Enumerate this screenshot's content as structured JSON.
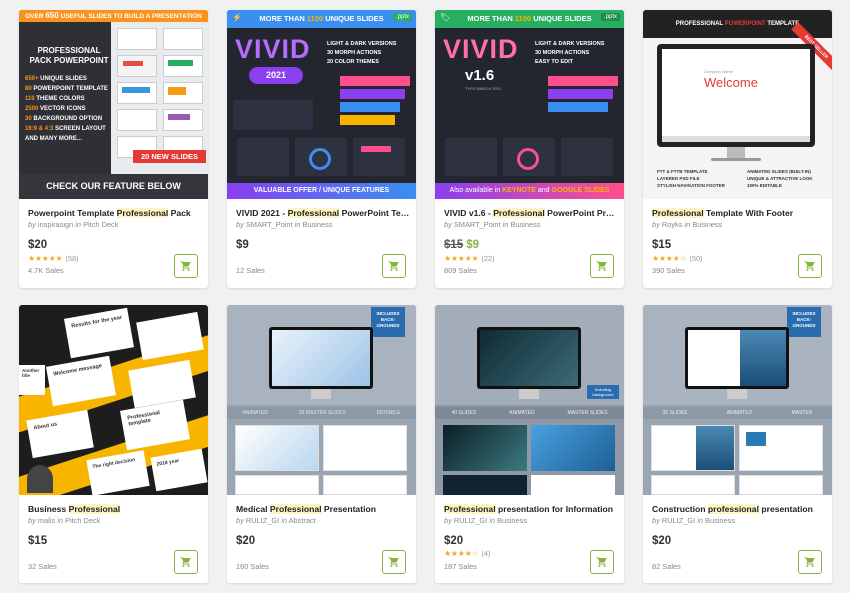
{
  "cards": [
    {
      "title_pre": "Powerpoint Template ",
      "title_hl": "Professional",
      "title_post": " Pack",
      "by": "by",
      "author": "inspirasign",
      "in": "in",
      "category": "Pitch Deck",
      "price": "$20",
      "old_price": "",
      "rating_count": "(58)",
      "rating_stars": 4.5,
      "sales": "4.7K Sales",
      "thumb": {
        "banner_pre": "OVER ",
        "banner_num": "650",
        "banner_post": " USEFUL SLIDES TO BUILD A PRESENTATION",
        "heading": "PROFESSIONAL PACK POWERPOINT",
        "features": [
          {
            "num": "650+",
            "text": " UNIQUE SLIDES"
          },
          {
            "num": "80",
            "text": " POWERPOINT TEMPLATE"
          },
          {
            "num": "110",
            "text": " THEME COLORS"
          },
          {
            "num": "2500",
            "text": " VECTOR ICONS"
          },
          {
            "num": "30",
            "text": " BACKGROUND OPTION"
          },
          {
            "num": "16:9 & 4:3",
            "text": " SCREEN LAYOUT"
          },
          {
            "num": "",
            "text": "AND MANY MORE..."
          }
        ],
        "badge": "20 NEW SLIDES",
        "footer": "CHECK OUR FEATURE BELOW"
      }
    },
    {
      "title_pre": "VIVID 2021 - ",
      "title_hl": "Professional",
      "title_post": " PowerPoint Template",
      "by": "by",
      "author": "SMART_Point",
      "in": "in",
      "category": "Business",
      "price": "$9",
      "old_price": "",
      "rating_count": "",
      "rating_stars": 0,
      "sales": "12 Sales",
      "thumb": {
        "banner_pre": "MORE THAN ",
        "banner_num": "1100",
        "banner_post": " UNIQUE SLIDES",
        "tag": ".pptx",
        "logo": "VIVID",
        "version": "2021",
        "bullets": [
          "LIGHT & DARK VERSIONS",
          "30 MORPH ACTIONS",
          "20 COLOR THEMES"
        ],
        "footer": "VALUABLE OFFER / UNIQUE FEATURES"
      }
    },
    {
      "title_pre": "VIVID v1.6 - ",
      "title_hl": "Professional",
      "title_post": " PowerPoint Presentation",
      "by": "by",
      "author": "SMART_Point",
      "in": "in",
      "category": "Business",
      "price": "$9",
      "old_price": "$15",
      "rating_count": "(22)",
      "rating_stars": 5,
      "sales": "809 Sales",
      "thumb": {
        "banner_pre": "MORE THAN ",
        "banner_num": "1100",
        "banner_post": " UNIQUE SLIDES",
        "tag": ".pptx",
        "logo": "VIVID",
        "version": "v1.6",
        "update": "TYPE MARCH 2021",
        "bullets": [
          "LIGHT & DARK VERSIONS",
          "30 MORPH ACTIONS",
          "EASY TO EDIT"
        ],
        "footer_pre": "Also available in ",
        "footer_a": "KEYNOTE",
        "footer_mid": " and ",
        "footer_b": "GOOGLE SLIDES"
      }
    },
    {
      "title_pre": "",
      "title_hl": "Professional",
      "title_post": " Template With Footer",
      "by": "by",
      "author": "Royks",
      "in": "in",
      "category": "Business",
      "price": "$15",
      "old_price": "",
      "rating_count": "(50)",
      "rating_stars": 4,
      "sales": "390 Sales",
      "thumb": {
        "heading_pre": "PROFESSIONAL ",
        "heading_hl": "POWERPOINT",
        "heading_post": " TEMPLATE",
        "ribbon": "BEST SELLER",
        "screen_small": "Company Name",
        "screen_title": "Welcome",
        "features_left": [
          "FTT & FTTB TEMPLATE",
          "LAYERED PSD FILE",
          "STYLISH NAVIGATION FOOTER"
        ],
        "features_right": [
          "ANIMATED SLIDES (BUILT-IN)",
          "UNIQUE & ATTRACTIVE LOOK",
          "100% EDITABLE"
        ]
      }
    },
    {
      "title_pre": "Business ",
      "title_hl": "Professional",
      "title_post": "",
      "by": "by",
      "author": "malis",
      "in": "in",
      "category": "Pitch Deck",
      "price": "$15",
      "old_price": "",
      "rating_count": "",
      "rating_stars": 0,
      "sales": "32 Sales",
      "thumb": {
        "slides": [
          "Results for the year",
          "Welcome message",
          "Professional template",
          "About us",
          "The right decision",
          "2018 year",
          "Another title"
        ]
      }
    },
    {
      "title_pre": "Medical ",
      "title_hl": "Professional",
      "title_post": " Presentation",
      "by": "by",
      "author": "RULIZ_GI",
      "in": "in",
      "category": "Abstract",
      "price": "$20",
      "old_price": "",
      "rating_count": "",
      "rating_stars": 0,
      "sales": "160 Sales",
      "thumb": {
        "badge": "INCLUDES BACK-GROUNDS",
        "strip": [
          "ANIMATED",
          "25 MASTER SLIDES",
          "EDITABLE"
        ]
      }
    },
    {
      "title_pre": "",
      "title_hl": "Professional",
      "title_post": " presentation for Information",
      "by": "by",
      "author": "RULIZ_GI",
      "in": "in",
      "category": "Business",
      "price": "$20",
      "old_price": "",
      "rating_count": "(4)",
      "rating_stars": 4,
      "sales": "187 Sales",
      "thumb": {
        "badge": "Including background",
        "strip": [
          "40 SLIDES",
          "ANIMATED",
          "MASTER SLIDES"
        ]
      }
    },
    {
      "title_pre": "Construction ",
      "title_hl": "professional",
      "title_post": " presentation",
      "by": "by",
      "author": "RULIZ_GI",
      "in": "in",
      "category": "Business",
      "price": "$20",
      "old_price": "",
      "rating_count": "",
      "rating_stars": 0,
      "sales": "82 Sales",
      "thumb": {
        "badge": "INCLUDES BACK-GROUNDS",
        "strip": [
          "30 SLIDES",
          "ANIMATED",
          "MASTER"
        ]
      }
    }
  ],
  "colors": {
    "accent_green": "#82b541",
    "star": "#f0a92a",
    "highlight": "#fdf5c6",
    "vivid_purple": "#8a3ff0",
    "pack_orange": "#f7931e",
    "yellow": "#f7b500"
  },
  "icons": {
    "cart": "shopping-cart-icon",
    "star": "star-icon"
  }
}
